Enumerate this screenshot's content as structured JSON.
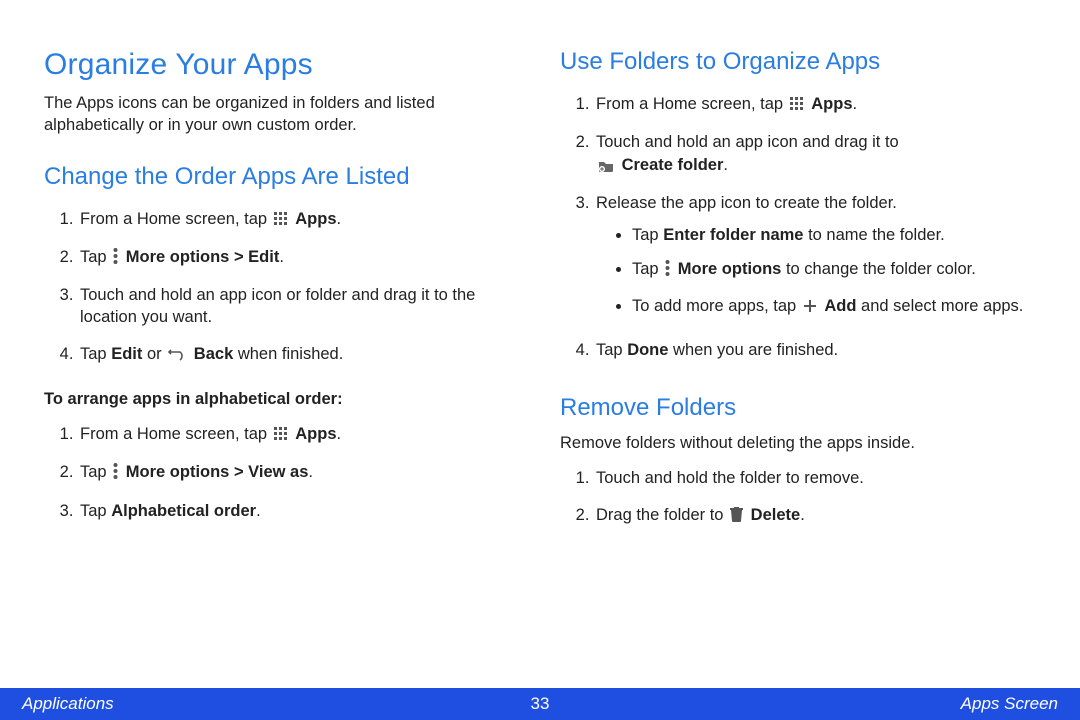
{
  "left": {
    "h1": "Organize Your Apps",
    "intro": "The Apps icons can be organized in folders and listed alphabetically or in your own custom order.",
    "h2a": "Change the Order Apps Are Listed",
    "s1_pre": "From a Home screen, tap ",
    "s1_b": "Apps",
    "s1_post": ".",
    "s2_pre": "Tap ",
    "s2_b": "More options > Edit",
    "s2_post": ".",
    "s3": "Touch and hold an app icon or folder and drag it to the location you want.",
    "s4_pre": "Tap ",
    "s4_b1": "Edit",
    "s4_mid": " or ",
    "s4_b2": "Back",
    "s4_post": " when finished.",
    "sub": "To arrange apps in alphabetical order:",
    "a1_pre": "From a Home screen, tap ",
    "a1_b": "Apps",
    "a1_post": ".",
    "a2_pre": "Tap ",
    "a2_b": "More options > View as",
    "a2_post": ".",
    "a3_pre": "Tap ",
    "a3_b": "Alphabetical order",
    "a3_post": "."
  },
  "right": {
    "h2a": "Use Folders to Organize Apps",
    "f1_pre": "From a Home screen, tap ",
    "f1_b": "Apps",
    "f1_post": ".",
    "f2_pre": "Touch and hold an app icon and drag it to ",
    "f2_b": "Create folder",
    "f2_post": ".",
    "f3": "Release the app icon to create the folder.",
    "b1_pre": "Tap ",
    "b1_b": "Enter folder name",
    "b1_post": " to name the folder.",
    "b2_pre": "Tap ",
    "b2_b": "More options",
    "b2_post": " to change the folder color.",
    "b3_pre": "To add more apps, tap ",
    "b3_b": "Add",
    "b3_post": " and select more apps.",
    "f4_pre": "Tap ",
    "f4_b": "Done",
    "f4_post": " when you are finished.",
    "h2b": "Remove Folders",
    "rintro": "Remove folders without deleting the apps inside.",
    "r1": "Touch and hold the folder to remove.",
    "r2_pre": "Drag the folder to ",
    "r2_b": "Delete",
    "r2_post": "."
  },
  "footer": {
    "left": "Applications",
    "center": "33",
    "right": "Apps Screen"
  }
}
